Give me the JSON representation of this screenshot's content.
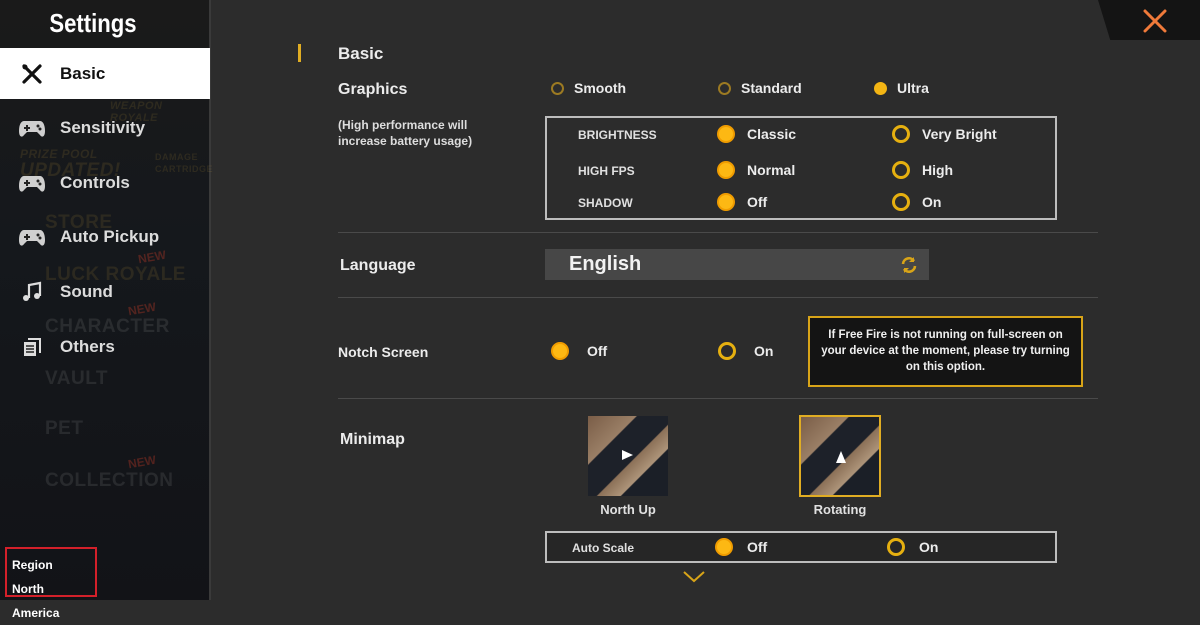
{
  "sidebar": {
    "title": "Settings",
    "items": [
      {
        "label": "Basic",
        "icon": "tools-icon",
        "active": true
      },
      {
        "label": "Sensitivity",
        "icon": "gamepad-icon"
      },
      {
        "label": "Controls",
        "icon": "gamepad-icon"
      },
      {
        "label": "Auto Pickup",
        "icon": "gamepad-icon"
      },
      {
        "label": "Sound",
        "icon": "music-note-icon"
      },
      {
        "label": "Others",
        "icon": "documents-icon"
      }
    ],
    "background_menu": [
      "WEAPON ROYALE",
      "PRIZE POOL",
      "UPDATED!",
      "DAMAGE",
      "CARTRIDGE",
      "STORE",
      "LUCK ROYALE",
      "CHARACTER",
      "VAULT",
      "PET",
      "COLLECTION",
      "NEW"
    ],
    "region": {
      "label": "Region",
      "value": "North America"
    }
  },
  "close_icon": "close-x-icon",
  "accent": "#f3b514",
  "main": {
    "section_title": "Basic",
    "graphics": {
      "label": "Graphics",
      "note": "(High performance will increase battery usage)",
      "options": [
        "Smooth",
        "Standard",
        "Ultra"
      ],
      "selected": "Ultra",
      "sub": [
        {
          "label": "BRIGHTNESS",
          "options": [
            "Classic",
            "Very Bright"
          ],
          "selected": "Classic"
        },
        {
          "label": "HIGH FPS",
          "options": [
            "Normal",
            "High"
          ],
          "selected": "Normal"
        },
        {
          "label": "SHADOW",
          "options": [
            "Off",
            "On"
          ],
          "selected": "Off"
        }
      ]
    },
    "language": {
      "label": "Language",
      "value": "English",
      "icon": "refresh-icon"
    },
    "notch": {
      "label": "Notch Screen",
      "options": [
        "Off",
        "On"
      ],
      "selected": "Off",
      "tooltip": "If Free Fire is not running on full-screen on your device at the moment, please try turning on this option."
    },
    "minimap": {
      "label": "Minimap",
      "options": [
        "North Up",
        "Rotating"
      ],
      "selected": "Rotating"
    },
    "auto_scale": {
      "label": "Auto Scale",
      "options": [
        "Off",
        "On"
      ],
      "selected": "Off"
    },
    "scroll_icon": "chevron-down-icon"
  }
}
